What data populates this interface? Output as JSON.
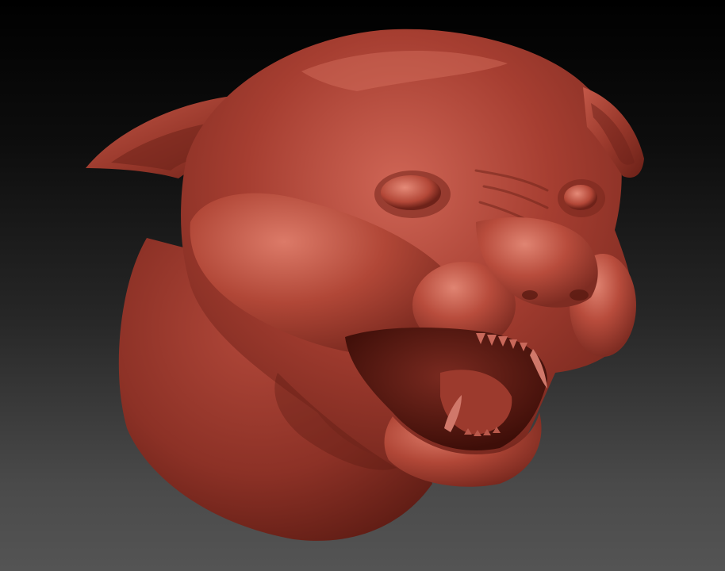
{
  "scene": {
    "subject": "sculpted-feline-head-icon",
    "colors": {
      "background_top": "#000000",
      "background_bottom": "#545454",
      "clay_base": "#a13b2f",
      "clay_highlight": "#d9715f",
      "clay_shadow": "#5a1a12",
      "mouth_interior": "#4a120c",
      "teeth": "#c9685a"
    }
  }
}
